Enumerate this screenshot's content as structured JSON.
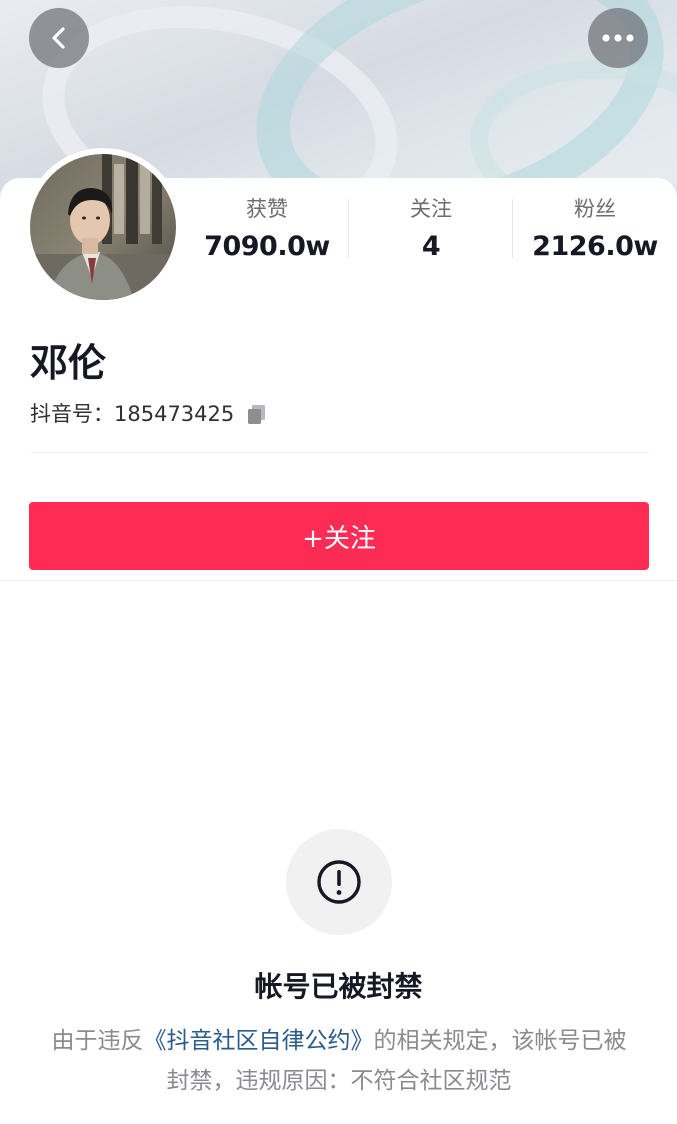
{
  "header": {
    "back_icon": "chevron-left-icon",
    "more_icon": "ellipsis-icon"
  },
  "profile": {
    "avatar": "avatar-photo",
    "name": "邓伦",
    "id_label": "抖音号：",
    "id_value": "185473425",
    "copy_icon": "copy-icon"
  },
  "stats": [
    {
      "label": "获赞",
      "value": "7090.0w"
    },
    {
      "label": "关注",
      "value": "4"
    },
    {
      "label": "粉丝",
      "value": "2126.0w"
    }
  ],
  "follow_button": {
    "label": "+关注",
    "color": "#fe2c55"
  },
  "banned": {
    "icon": "exclamation-circle-icon",
    "title": "帐号已被封禁",
    "desc_prefix": "由于违反",
    "pact_link": "《抖音社区自律公约》",
    "desc_suffix": "的相关规定，该帐号已被封禁，违规原因：不符合社区规范"
  }
}
